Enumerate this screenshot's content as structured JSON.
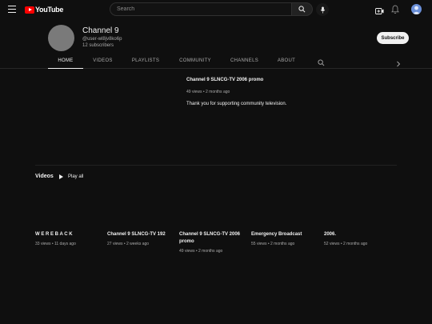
{
  "header": {
    "logo_text": "YouTube",
    "search_placeholder": "Search"
  },
  "channel": {
    "name": "Channel 9",
    "handle": "@user-wl8jv8ko6p",
    "subscribers": "12 subscribers",
    "subscribe_label": "Subscribe"
  },
  "tabs": [
    {
      "label": "HOME",
      "active": true
    },
    {
      "label": "VIDEOS",
      "active": false
    },
    {
      "label": "PLAYLISTS",
      "active": false
    },
    {
      "label": "COMMUNITY",
      "active": false
    },
    {
      "label": "CHANNELS",
      "active": false
    },
    {
      "label": "ABOUT",
      "active": false
    }
  ],
  "featured": {
    "title": "Channel 9 SLNCG-TV 2006 promo",
    "meta": "49 views • 2 months ago",
    "description": "Thank you for supporting community television."
  },
  "shelf": {
    "title": "Videos",
    "play_all_label": "Play all"
  },
  "videos": [
    {
      "title": "W E R E B A C K",
      "meta": "33 views • 11 days ago"
    },
    {
      "title": "Channel 9 SLNCG-TV 192",
      "meta": "27 views • 2 weeks ago"
    },
    {
      "title": "Channel 9 SLNCG-TV 2006 promo",
      "meta": "49 views • 2 months ago"
    },
    {
      "title": "Emergency Broadcast",
      "meta": "55 views • 2 months ago"
    },
    {
      "title": "2006.",
      "meta": "52 views • 2 months ago"
    }
  ],
  "icons": {
    "menu": "menu-icon",
    "search": "search-icon",
    "mic": "mic-icon",
    "create": "create-video-icon",
    "notifications": "bell-icon",
    "avatar": "account-avatar-icon",
    "play_all": "play-icon",
    "tab_search": "search-icon",
    "tabs_next": "chevron-right-icon"
  },
  "colors": {
    "background": "#0f0f0f",
    "brand_red": "#ff0000",
    "text_primary": "#f1f1f1",
    "text_secondary": "#aaaaaa",
    "account_avatar": "#6a8fd8"
  }
}
